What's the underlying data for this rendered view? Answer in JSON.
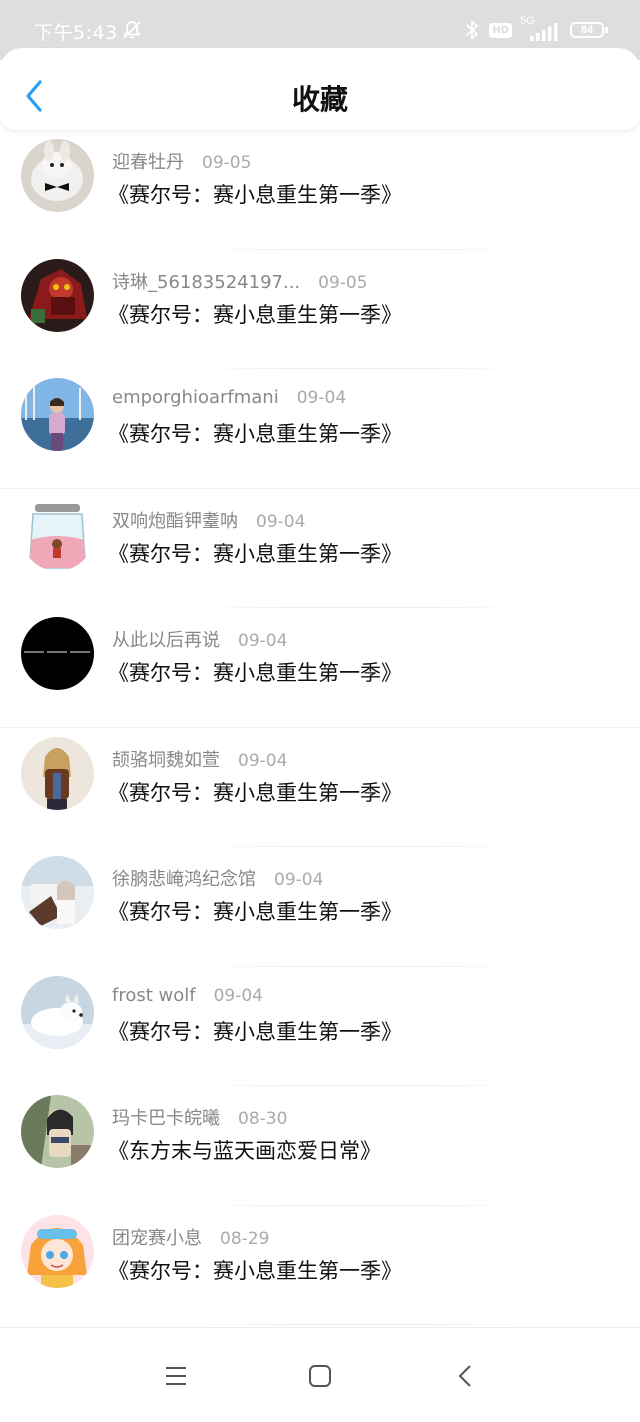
{
  "status_bar": {
    "time": "下午5:43",
    "network": "5G",
    "hd": "HD",
    "battery": "84",
    "icons": [
      "mute-icon",
      "bluetooth-icon",
      "hd-icon",
      "signal-icon",
      "battery-icon"
    ]
  },
  "header": {
    "title": "收藏",
    "back_icon": "chevron-left-icon",
    "accent": "#2a9df4"
  },
  "favorites": [
    {
      "user": "迎春牡丹",
      "date": "09-05",
      "title": "《赛尔号：赛小息重生第一季》"
    },
    {
      "user": "诗琳_56183524197...",
      "date": "09-05",
      "title": "《赛尔号：赛小息重生第一季》"
    },
    {
      "user": "emporghioarfmani",
      "date": "09-04",
      "title": "《赛尔号：赛小息重生第一季》"
    },
    {
      "user": "双响炮酯钾耋呐",
      "date": "09-04",
      "title": "《赛尔号：赛小息重生第一季》"
    },
    {
      "user": "从此以后再说",
      "date": "09-04",
      "title": "《赛尔号：赛小息重生第一季》"
    },
    {
      "user": "颉骆垌魏如萱",
      "date": "09-04",
      "title": "《赛尔号：赛小息重生第一季》"
    },
    {
      "user": "徐朒悲崦鸿纪念馆",
      "date": "09-04",
      "title": "《赛尔号：赛小息重生第一季》"
    },
    {
      "user": "frost wolf",
      "date": "09-04",
      "title": "《赛尔号：赛小息重生第一季》"
    },
    {
      "user": "玛卡巴卡皖曦",
      "date": "08-30",
      "title": "《东方末与蓝天画恋爱日常》"
    },
    {
      "user": "团宠赛小息",
      "date": "08-29",
      "title": "《赛尔号：赛小息重生第一季》"
    }
  ],
  "nav": {
    "icons": [
      "menu-icon",
      "home-square-icon",
      "back-triangle-icon"
    ]
  }
}
